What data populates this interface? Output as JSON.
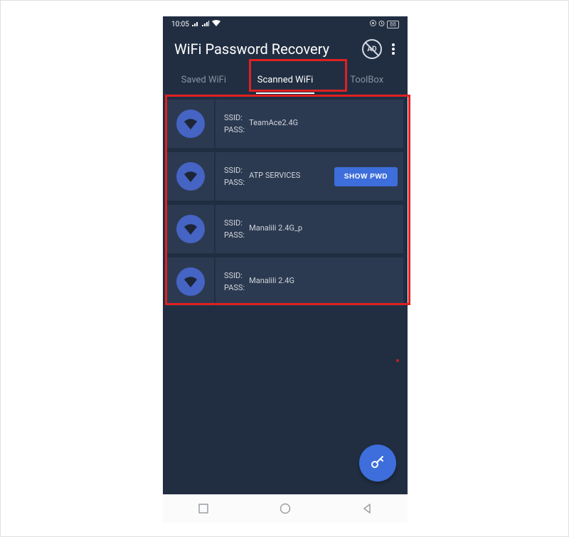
{
  "status": {
    "time": "10:05",
    "battery": "88"
  },
  "header": {
    "title": "WiFi Password Recovery",
    "ad": "AD"
  },
  "tabs": {
    "saved": "Saved WiFi",
    "scanned": "Scanned WiFi",
    "toolbox": "ToolBox"
  },
  "labels": {
    "ssid": "SSID:",
    "pass": "PASS:"
  },
  "buttons": {
    "show_pwd": "SHOW PWD"
  },
  "networks": [
    {
      "ssid": "TeamAce2.4G",
      "pass": "",
      "show_btn": false
    },
    {
      "ssid": "ATP SERVICES",
      "pass": "",
      "show_btn": true
    },
    {
      "ssid": "Manalili 2.4G_p",
      "pass": "",
      "show_btn": false
    },
    {
      "ssid": "Manalili 2.4G",
      "pass": "",
      "show_btn": false
    }
  ]
}
